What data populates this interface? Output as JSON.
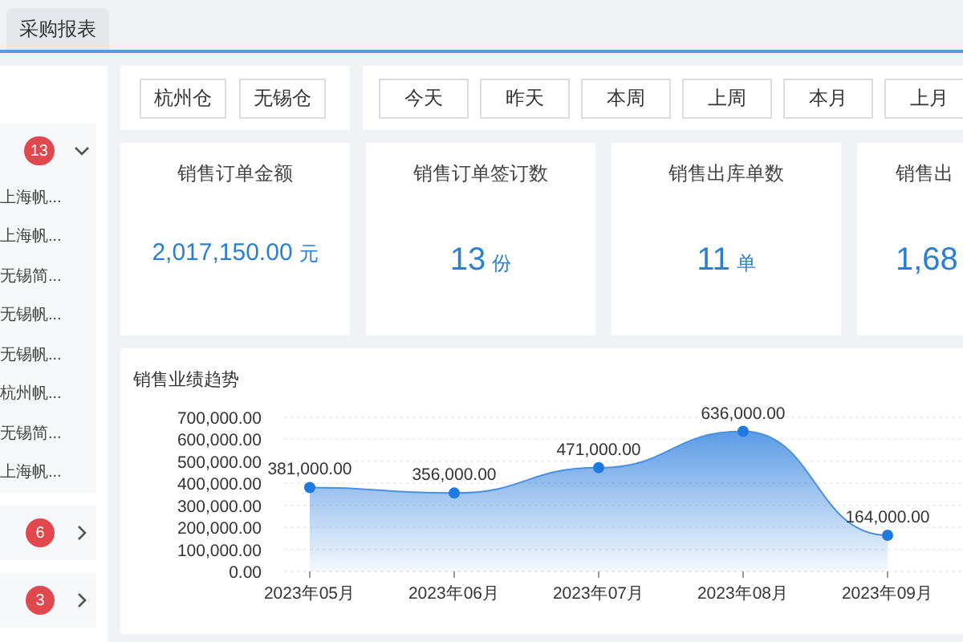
{
  "tabs": [
    {
      "label": "采购报表",
      "selected": true
    }
  ],
  "sidebar": {
    "groups": [
      {
        "badge": "13",
        "expanded": true,
        "items": [
          "上海帆...",
          "上海帆...",
          "无锡简...",
          "无锡帆...",
          "无锡帆...",
          "杭州帆...",
          "无锡简...",
          "上海帆..."
        ]
      },
      {
        "badge": "6",
        "expanded": false
      },
      {
        "badge": "3",
        "expanded": false
      }
    ]
  },
  "warehouse_buttons": [
    "杭州仓",
    "无锡仓"
  ],
  "period_buttons": [
    "今天",
    "昨天",
    "本周",
    "上周",
    "本月",
    "上月"
  ],
  "stats": [
    {
      "title": "销售订单金额",
      "value": "2,017,150.00",
      "unit": "元"
    },
    {
      "title": "销售订单签订数",
      "value": "13",
      "unit": "份"
    },
    {
      "title": "销售出库单数",
      "value": "11",
      "unit": "单"
    },
    {
      "title": "销售出",
      "value": "1,68"
    }
  ],
  "chart": {
    "title": "销售业绩趋势",
    "chart_data": {
      "type": "area",
      "grid": true,
      "categories": [
        "2023年05月",
        "2023年06月",
        "2023年07月",
        "2023年08月",
        "2023年09月"
      ],
      "series": [
        {
          "color": "#4a90e2",
          "values": [
            381000,
            356000,
            471000,
            636000,
            164000
          ]
        }
      ],
      "ylim": [
        0,
        700000
      ],
      "yticks": [
        {
          "value": 0,
          "label": "0.00"
        },
        {
          "value": 100000,
          "label": "100,000.00"
        },
        {
          "value": 200000,
          "label": "200,000.00"
        },
        {
          "value": 300000,
          "label": "300,000.00"
        },
        {
          "value": 400000,
          "label": "400,000.00"
        },
        {
          "value": 500000,
          "label": "500,000.00"
        },
        {
          "value": 600000,
          "label": "600,000.00"
        },
        {
          "value": 700000,
          "label": "700,000.00"
        }
      ],
      "value_labels": [
        "381,000.00",
        "356,000.00",
        "471,000.00",
        "636,000.00",
        "164,000.00"
      ]
    }
  }
}
